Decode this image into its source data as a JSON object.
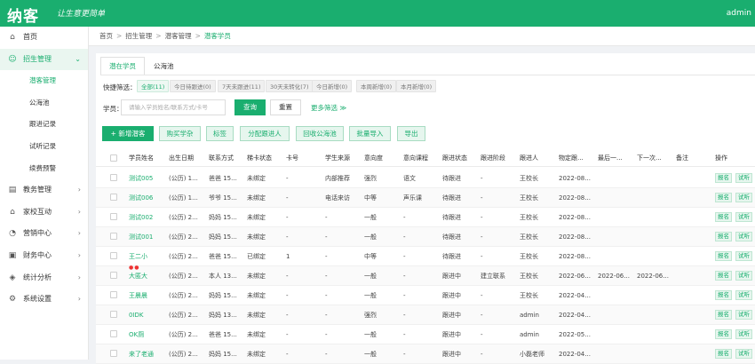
{
  "header": {
    "logo": "纳客",
    "slogan": "让生意更简单",
    "user": "admin"
  },
  "sidebar": {
    "items": [
      {
        "label": "首页",
        "icon": "home-icon",
        "glyph": "⌂",
        "expandable": false
      },
      {
        "label": "招生管理",
        "icon": "user-icon",
        "glyph": "☺",
        "expandable": true,
        "open": true,
        "children": [
          {
            "label": "潜客管理",
            "active": true
          },
          {
            "label": "公海池"
          },
          {
            "label": "跟进记录"
          },
          {
            "label": "试听记录"
          },
          {
            "label": "续费预警"
          }
        ]
      },
      {
        "label": "教务管理",
        "icon": "book-icon",
        "glyph": "▤",
        "expandable": true
      },
      {
        "label": "家校互动",
        "icon": "house-icon",
        "glyph": "⌂",
        "expandable": true
      },
      {
        "label": "营销中心",
        "icon": "megaphone-icon",
        "glyph": "◔",
        "expandable": true
      },
      {
        "label": "财务中心",
        "icon": "wallet-icon",
        "glyph": "▣",
        "expandable": true
      },
      {
        "label": "统计分析",
        "icon": "chart-icon",
        "glyph": "◈",
        "expandable": true
      },
      {
        "label": "系统设置",
        "icon": "gear-icon",
        "glyph": "⚙",
        "expandable": true
      }
    ]
  },
  "breadcrumb": [
    "首页",
    "招生管理",
    "潜客管理",
    "潜客学员"
  ],
  "tabs": [
    {
      "label": "潜在学员",
      "active": true
    },
    {
      "label": "公海池"
    }
  ],
  "quick_filter": {
    "label": "快捷筛选：",
    "chips": [
      "全部(11)",
      "今日待跟进(0)",
      "7天未跟进(11)",
      "30天未转化(7)",
      "今日新增(0)",
      "本周新增(0)",
      "本月新增(0)"
    ]
  },
  "search": {
    "label": "学员：",
    "placeholder": "请输入学员姓名/联系方式/卡号",
    "submit": "查询",
    "reset": "重置",
    "more": "更多筛选 ≫"
  },
  "actions": [
    "+ 新增潜客",
    "购买学杂",
    "标签",
    "分配跟进人",
    "回收公海池",
    "批量导入",
    "导出"
  ],
  "table": {
    "columns": [
      "学员姓名",
      "出生日期",
      "联系方式",
      "梯卡状态",
      "卡号",
      "学生来源",
      "意向度",
      "意向课程",
      "跟进状态",
      "跟进阶段",
      "跟进人",
      "物定跟...",
      "最后一...",
      "下一次...",
      "备注",
      "操作"
    ],
    "rows": [
      [
        "测试005",
        "(公历) 1...",
        "爸爸 15...",
        "未绑定",
        "-",
        "内部推荐",
        "强烈",
        "语文",
        "待跟进",
        "-",
        "王校长",
        "2022-08...",
        "",
        "",
        "",
        ""
      ],
      [
        "测试006",
        "(公历) 1...",
        "爷爷 15...",
        "未绑定",
        "-",
        "电话来访",
        "中等",
        "声乐课",
        "待跟进",
        "-",
        "王校长",
        "2022-08...",
        "",
        "",
        "",
        ""
      ],
      [
        "测试002",
        "(公历) 2...",
        "妈妈 15...",
        "未绑定",
        "-",
        "-",
        "一般",
        "-",
        "待跟进",
        "-",
        "王校长",
        "2022-08...",
        "",
        "",
        "",
        ""
      ],
      [
        "测试001",
        "(公历) 2...",
        "妈妈 15...",
        "未绑定",
        "-",
        "-",
        "一般",
        "-",
        "待跟进",
        "-",
        "王校长",
        "2022-08...",
        "",
        "",
        "",
        ""
      ],
      [
        "王二小",
        "(公历) 2...",
        "爸爸 15...",
        "已绑定",
        "1",
        "-",
        "中等",
        "-",
        "待跟进",
        "-",
        "王校长",
        "2022-08...",
        "",
        "",
        "",
        ""
      ],
      [
        "大匿大",
        "(公历) 2...",
        "本人 13...",
        "未绑定",
        "-",
        "-",
        "一般",
        "-",
        "跟进中",
        "建立联系",
        "王校长",
        "2022-06...",
        "2022-06...",
        "2022-06...",
        "",
        ""
      ],
      [
        "王晨晨",
        "(公历) 2...",
        "妈妈 15...",
        "未绑定",
        "-",
        "-",
        "一般",
        "-",
        "跟进中",
        "-",
        "王校长",
        "2022-04...",
        "",
        "",
        "",
        ""
      ],
      [
        "0IDK",
        "(公历) 2...",
        "妈妈 13...",
        "未绑定",
        "-",
        "-",
        "强烈",
        "-",
        "跟进中",
        "-",
        "admin",
        "2022-04...",
        "",
        "",
        "",
        ""
      ],
      [
        "OK厕",
        "(公历) 2...",
        "爸爸 15...",
        "未绑定",
        "-",
        "-",
        "一般",
        "-",
        "跟进中",
        "-",
        "admin",
        "2022-05...",
        "",
        "",
        "",
        ""
      ],
      [
        "来了老通",
        "(公历) 2...",
        "妈妈 15...",
        "未绑定",
        "-",
        "-",
        "一般",
        "-",
        "跟进中",
        "-",
        "小磊老师",
        "2022-04...",
        "",
        "",
        "",
        ""
      ]
    ],
    "row_flags": {
      "5": "●●"
    },
    "row_ops": [
      "报名",
      "试听"
    ]
  },
  "colors": {
    "brand": "#1aae6f"
  }
}
